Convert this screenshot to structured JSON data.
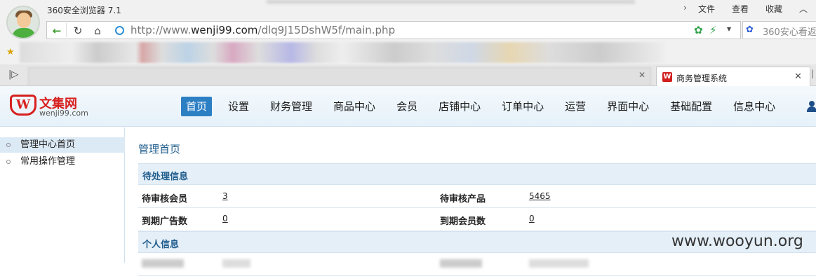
{
  "browser": {
    "app_title": "360安全浏览器 7.1",
    "menu": [
      "文件",
      "查看",
      "收藏"
    ],
    "url_prefix": "http://www.",
    "url_domain": "wenji99.com",
    "url_path": "/dlq9J15DshW5f/main.php",
    "search_placeholder": "360安心看返",
    "active_tab_label": "商务管理系统",
    "active_tab_favicon": "W"
  },
  "site": {
    "logo_mark": "W",
    "logo_name": "文集网",
    "logo_domain": "wenji99.com",
    "nav": [
      "首页",
      "设置",
      "财务管理",
      "商品中心",
      "会员",
      "店铺中心",
      "订单中心",
      "运营",
      "界面中心",
      "基础配置",
      "信息中心"
    ],
    "nav_active": "首页"
  },
  "sidebar": {
    "items": [
      "管理中心首页",
      "常用操作管理"
    ]
  },
  "main": {
    "page_title": "管理首页",
    "pending_section_title": "待处理信息",
    "pending_rows": [
      {
        "label1": "待审核会员",
        "value1": "3",
        "label2": "待审核产品",
        "value2": "5465"
      },
      {
        "label1": "到期广告数",
        "value1": "0",
        "label2": "到期会员数",
        "value2": "0"
      }
    ],
    "personal_section_title": "个人信息"
  },
  "watermark": "www.wooyun.org",
  "colors": {
    "nav_active_bg": "#2d7fc4",
    "section_title": "#1e5c8c",
    "logo_red": "#d7201f"
  }
}
